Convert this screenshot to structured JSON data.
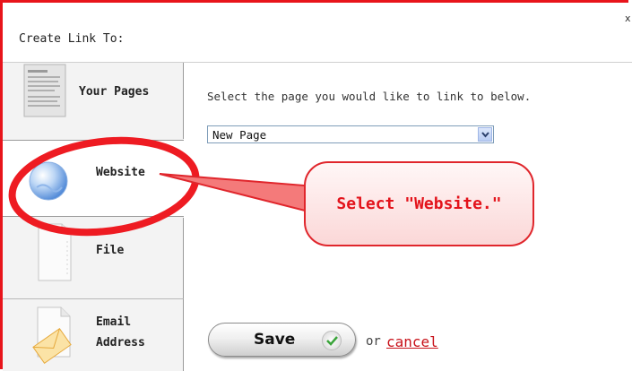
{
  "dialog": {
    "title": "Create Link To:",
    "close_glyph": "x"
  },
  "sidebar": {
    "items": [
      {
        "label": "Your Pages",
        "icon": "document-icon"
      },
      {
        "label": "Website",
        "icon": "globe-icon"
      },
      {
        "label": "File",
        "icon": "file-icon"
      },
      {
        "label_line1": "Email",
        "label_line2": "Address",
        "icon": "envelope-icon"
      }
    ]
  },
  "main": {
    "prompt": "Select the page you would like to link to below.",
    "page_select": {
      "selected": "New Page"
    }
  },
  "actions": {
    "save_label": "Save",
    "or_text": "or",
    "cancel_label": "cancel"
  },
  "annotation": {
    "callout_text": "Select \"Website.\"",
    "color": "#e3131b"
  },
  "colors": {
    "frame_red": "#e8141b",
    "link_red": "#c8121a",
    "sidebar_bg": "#f3f3f3"
  }
}
